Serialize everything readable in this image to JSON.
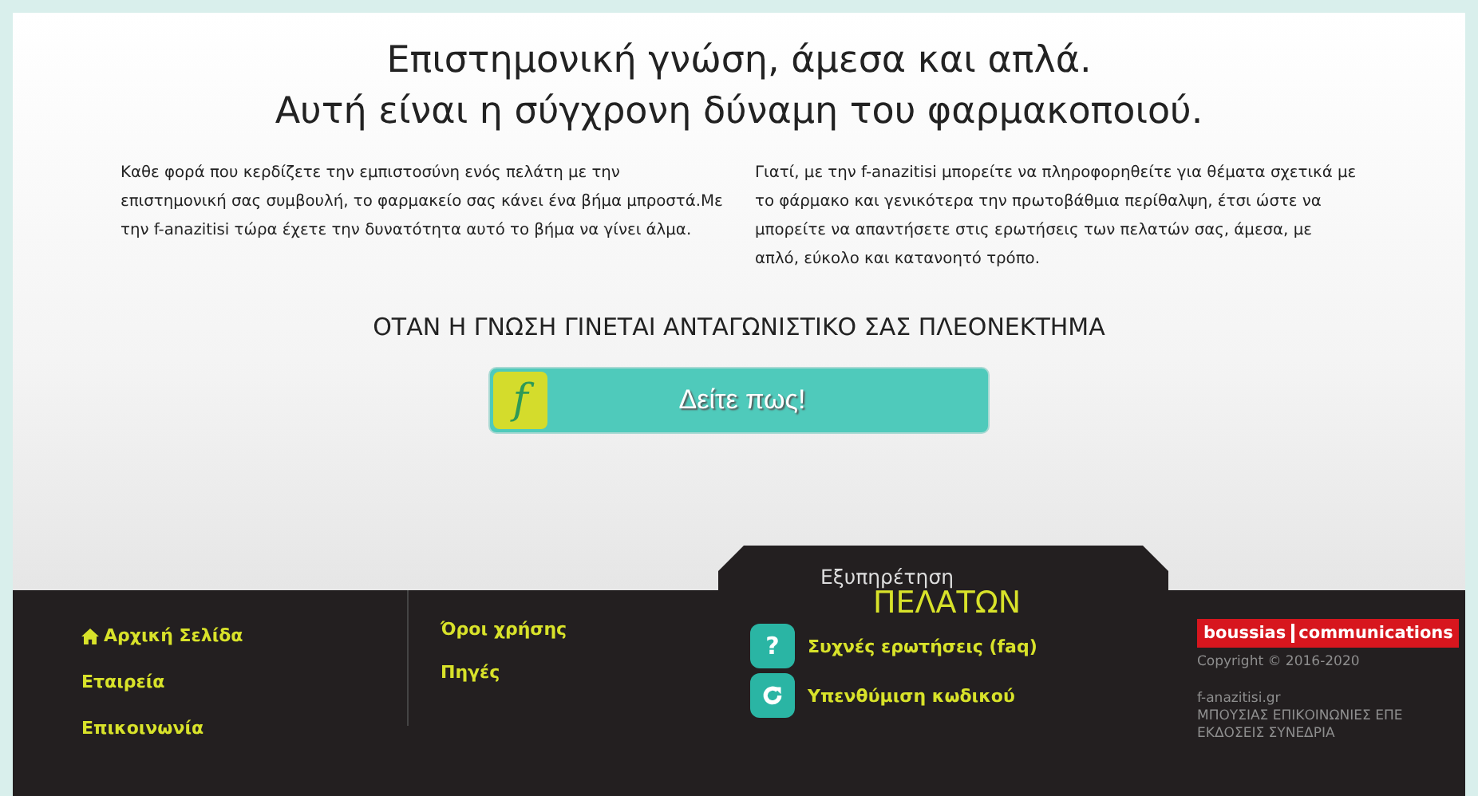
{
  "headline": [
    "Επιστημονική γνώση, άμεσα και απλά.",
    "Αυτή είναι η σύγχρονη δύναμη του φαρμακοποιού."
  ],
  "paragraphs": [
    "Καθε φορά που κερδίζετε την εμπιστοσύνη ενός πελάτη με την επιστημονική σας συμβουλή, το φαρμακείο σας κάνει ένα βήμα μπροστά.Με την f-anazitisi τώρα έχετε την δυνατότητα αυτό το βήμα να γίνει άλμα.",
    "Γιατί, με την f-anazitisi μπορείτε να πληροφορηθείτε για θέματα σχετικά με το φάρμακο και γενικότερα την πρωτοβάθμια περίθαλψη, έτσι ώστε να μπορείτε να απαντήσετε στις ερωτήσεις των πελατών σας, άμεσα, με απλό, εύκολο και κατανοητό τρόπο."
  ],
  "tagline": "ΟΤΑΝ Η ΓΝΩΣΗ ΓΙΝΕΤΑΙ ΑΝΤΑΓΩΝΙΣΤΙΚΟ ΣΑΣ ΠΛΕΟΝΕΚΤΗΜΑ",
  "cta": {
    "logo_letter": "f",
    "label": "Δείτε πως!"
  },
  "footer": {
    "nav_links": [
      {
        "label": "Αρχική Σελίδα",
        "kind": "home"
      },
      {
        "label": "Εταιρεία",
        "kind": "plain"
      },
      {
        "label": "Επικοινωνία",
        "kind": "plain"
      }
    ],
    "info_links": [
      "Όροι χρήσης",
      "Πηγές"
    ],
    "support": {
      "title": "Εξυπηρέτηση",
      "subtitle": "ΠΕΛΑΤΩΝ",
      "links": [
        {
          "label": "Συχνές ερωτήσεις (faq)",
          "kind": "glyph",
          "glyph": "?"
        },
        {
          "label": "Υπενθύμιση κωδικού",
          "kind": "refresh"
        }
      ]
    },
    "brand": {
      "left": "boussias",
      "right": "communications"
    },
    "copyright": "Copyright © 2016-2020",
    "site": "f-anazitisi.gr",
    "company": "ΜΠΟΥΣΙΑΣ ΕΠΙΚΟΙΝΩΝΙΕΣ ΕΠΕ ΕΚΔΟΣΕΙΣ ΣΥΝΕΔΡΙΑ"
  }
}
